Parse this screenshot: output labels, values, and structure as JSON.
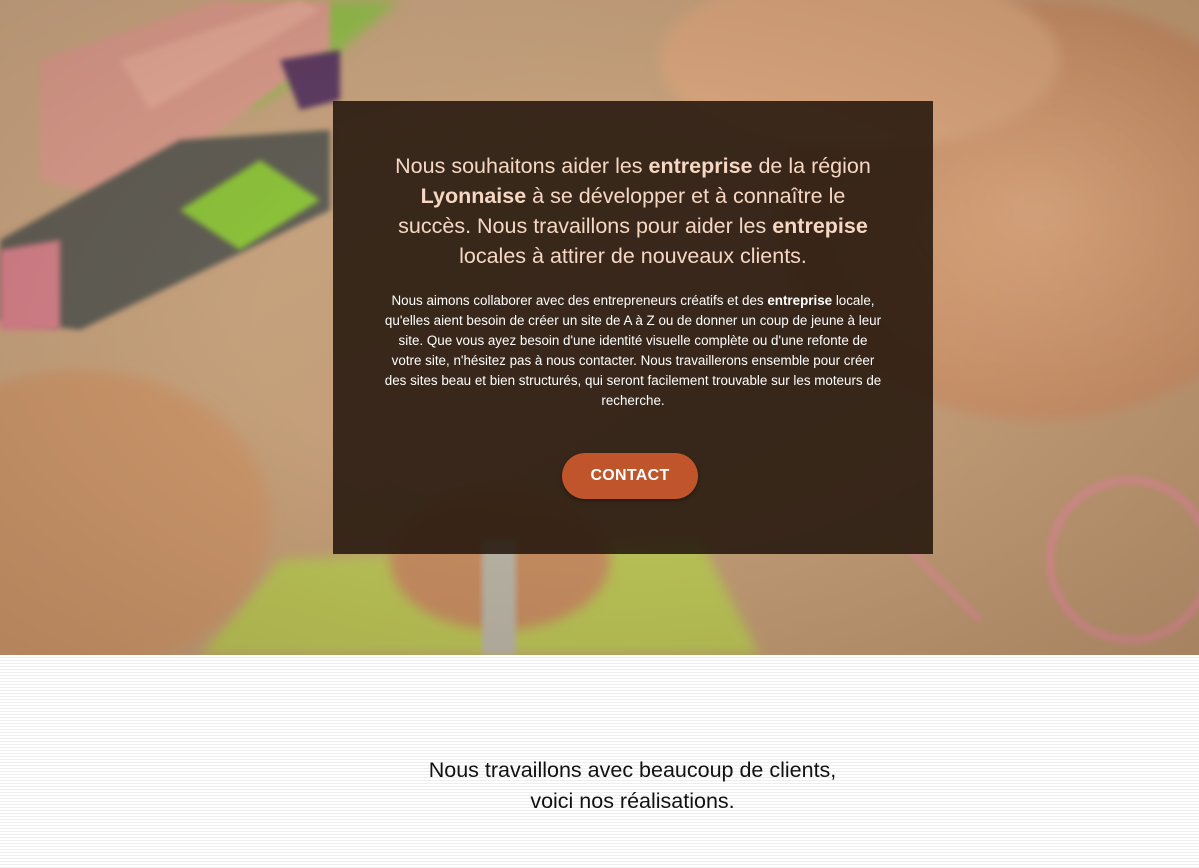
{
  "hero": {
    "lead": {
      "p1": "Nous souhaitons aider les ",
      "b1": "entreprise",
      "p2": " de la région ",
      "b2": "Lyonnaise",
      "p3": " à se développer et à connaître le succès. Nous travaillons pour aider les ",
      "b3": "entrepise",
      "p4": " locales à attirer de nouveaux clients."
    },
    "body": {
      "p1": "Nous aimons collaborer avec des entrepreneurs créatifs et des ",
      "b1": "entreprise",
      "p2": " locale, qu'elles aient besoin de créer un site de A à Z ou de donner un coup de jeune à leur site. Que vous ayez besoin d'une identité visuelle complète ou d'une refonte de votre site, n'hésitez pas à nous contacter. Nous travaillerons ensemble pour créer des sites beau et bien structurés, qui seront facilement trouvable sur les moteurs de recherche."
    },
    "contact_label": "CONTACT"
  },
  "section": {
    "line1": "Nous travaillons avec beaucoup de clients,",
    "line2": "voici nos réalisations."
  },
  "colors": {
    "overlay": "#21140b",
    "lead_text": "#f6d7c3",
    "button": "#c0552b",
    "hero_paper": "#c9a27d"
  },
  "icons": {
    "hero_image": "markers-and-hands-drawing-photo"
  }
}
